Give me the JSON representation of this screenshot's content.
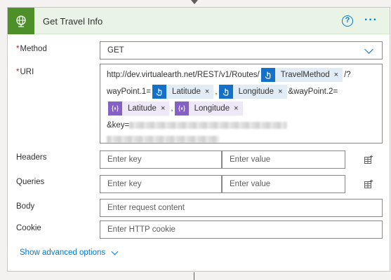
{
  "action": {
    "title": "Get Travel Info",
    "icon": "globe-icon",
    "accent_color": "#4d8f28"
  },
  "method": {
    "label": "Method",
    "required": "*",
    "value": "GET"
  },
  "uri": {
    "label": "URI",
    "required": "*",
    "prefix": "http://dev.virtualearth.net/REST/v1/Routes/",
    "suffix1": "/?",
    "line2_prefix": "wayPoint.1=",
    "comma": ",",
    "waypoint2": "&wayPoint.2=",
    "key_prefix": "&key=",
    "tokens": {
      "travel_method": "TravelMethod",
      "lat1": "Latitude",
      "lon1": "Longitude",
      "lat2": "Latitude",
      "lon2": "Longitude"
    },
    "remove": "×"
  },
  "headers": {
    "label": "Headers",
    "key_placeholder": "Enter key",
    "value_placeholder": "Enter value"
  },
  "queries": {
    "label": "Queries",
    "key_placeholder": "Enter key",
    "value_placeholder": "Enter value"
  },
  "body": {
    "label": "Body",
    "placeholder": "Enter request content"
  },
  "cookie": {
    "label": "Cookie",
    "placeholder": "Enter HTTP cookie"
  },
  "advanced": {
    "label": "Show advanced options"
  },
  "toolbar": {
    "help": "?",
    "more": "···"
  }
}
